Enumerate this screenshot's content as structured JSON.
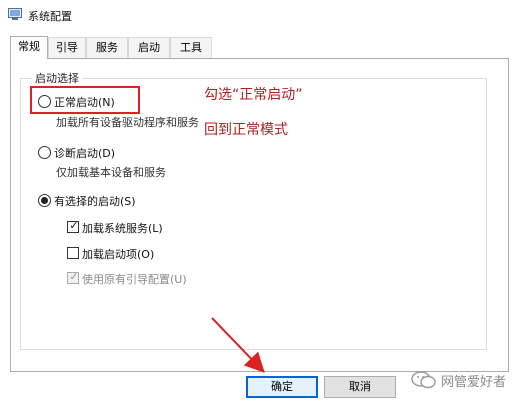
{
  "window": {
    "title": "系统配置",
    "icon": "system-config-icon"
  },
  "tabs": [
    {
      "label": "常规",
      "active": true
    },
    {
      "label": "引导",
      "active": false
    },
    {
      "label": "服务",
      "active": false
    },
    {
      "label": "启动",
      "active": false
    },
    {
      "label": "工具",
      "active": false
    }
  ],
  "startup": {
    "group_title": "启动选择",
    "options": [
      {
        "label": "正常启动(N)",
        "description": "加载所有设备驱动程序和服务",
        "selected": false
      },
      {
        "label": "诊断启动(D)",
        "description": "仅加载基本设备和服务",
        "selected": false
      },
      {
        "label": "有选择的启动(S)",
        "selected": true
      }
    ],
    "selective_items": [
      {
        "label": "加载系统服务(L)",
        "checked": true,
        "enabled": true
      },
      {
        "label": "加载启动项(O)",
        "checked": false,
        "enabled": true
      },
      {
        "label": "使用原有引导配置(U)",
        "checked": true,
        "enabled": false
      }
    ]
  },
  "annotation": {
    "line1": "勾选“正常启动”",
    "line2": "回到正常模式",
    "color": "#b02020"
  },
  "buttons": {
    "ok": "确定",
    "cancel": "取消"
  },
  "watermark": {
    "text": "网管爱好者",
    "icon": "wechat-icon"
  }
}
